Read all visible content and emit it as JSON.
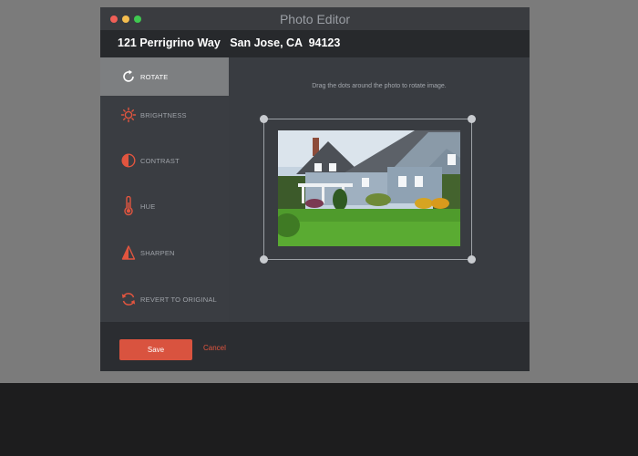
{
  "window": {
    "title": "Photo Editor"
  },
  "address": "121 Perrigrino Way   San Jose, CA  94123",
  "sidebar": {
    "items": [
      {
        "label": "ROTATE",
        "icon": "rotate-icon",
        "active": true
      },
      {
        "label": "BRIGHTNESS",
        "icon": "sun-icon"
      },
      {
        "label": "CONTRAST",
        "icon": "contrast-icon"
      },
      {
        "label": "HUE",
        "icon": "thermometer-icon"
      },
      {
        "label": "SHARPEN",
        "icon": "triangle-icon"
      },
      {
        "label": "REVERT TO ORIGINAL",
        "icon": "revert-icon"
      }
    ]
  },
  "editor": {
    "hint": "Drag the dots around the photo to rotate image."
  },
  "footer": {
    "save_label": "Save",
    "cancel_label": "Cancel"
  },
  "colors": {
    "accent": "#e1553f",
    "button": "#d9533f",
    "sidebar_active": "#7d7f81"
  }
}
